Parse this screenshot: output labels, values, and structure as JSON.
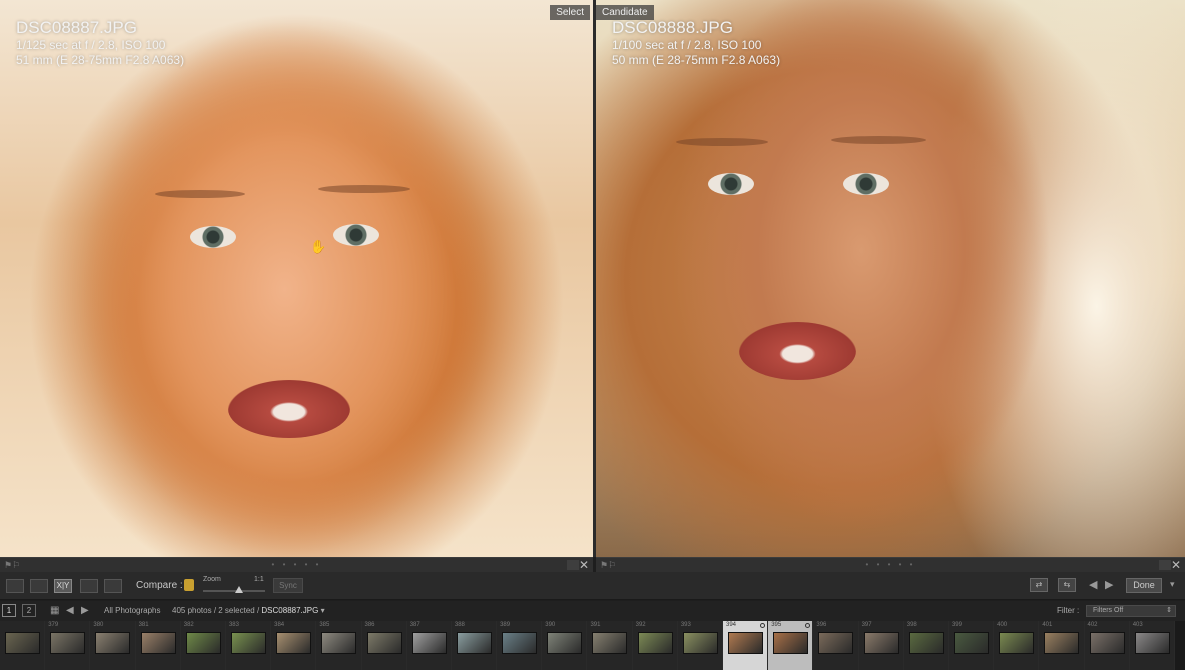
{
  "panes": {
    "select": {
      "tag": "Select",
      "filename": "DSC08887.JPG",
      "exposure": "1/125 sec at f / 2.8, ISO 100",
      "lens": "51 mm (E 28-75mm F2.8 A063)"
    },
    "candidate": {
      "tag": "Candidate",
      "filename": "DSC08888.JPG",
      "exposure": "1/100 sec at f / 2.8, ISO 100",
      "lens": "50 mm (E 28-75mm F2.8 A063)"
    }
  },
  "toolbar": {
    "compare_label": "Compare :",
    "zoom_label": "Zoom",
    "zoom_value": "1:1",
    "sync_label": "Sync",
    "done_label": "Done"
  },
  "filmstrip_header": {
    "monitor1": "1",
    "monitor2": "2",
    "source": "All Photographs",
    "count_text": "405 photos / 2 selected /",
    "current_file": "DSC08887.JPG",
    "filter_label": "Filter :",
    "filter_value": "Filters Off"
  },
  "thumbnails": [
    {
      "num": "",
      "color": "#6a6550"
    },
    {
      "num": "379",
      "color": "#7a7465"
    },
    {
      "num": "380",
      "color": "#8a8070"
    },
    {
      "num": "381",
      "color": "#9a8068"
    },
    {
      "num": "382",
      "color": "#6f8a48"
    },
    {
      "num": "383",
      "color": "#79924f"
    },
    {
      "num": "384",
      "color": "#a89070"
    },
    {
      "num": "385",
      "color": "#8e8a80"
    },
    {
      "num": "386",
      "color": "#7d7a68"
    },
    {
      "num": "387",
      "color": "#a0a0a0"
    },
    {
      "num": "388",
      "color": "#8a9ea0"
    },
    {
      "num": "389",
      "color": "#6a8088"
    },
    {
      "num": "390",
      "color": "#7f8378"
    },
    {
      "num": "391",
      "color": "#868070"
    },
    {
      "num": "392",
      "color": "#7c8a55"
    },
    {
      "num": "393",
      "color": "#8a9060"
    },
    {
      "num": "394",
      "color": "#b07a50",
      "selected": "primary"
    },
    {
      "num": "395",
      "color": "#a87048",
      "selected": "secondary"
    },
    {
      "num": "396",
      "color": "#7a6a5a"
    },
    {
      "num": "397",
      "color": "#8a7a6a"
    },
    {
      "num": "398",
      "color": "#5a6a40"
    },
    {
      "num": "399",
      "color": "#4a5a40"
    },
    {
      "num": "400",
      "color": "#7a8a50"
    },
    {
      "num": "401",
      "color": "#9a8060"
    },
    {
      "num": "402",
      "color": "#7a7068"
    },
    {
      "num": "403",
      "color": "#8a8888"
    }
  ]
}
